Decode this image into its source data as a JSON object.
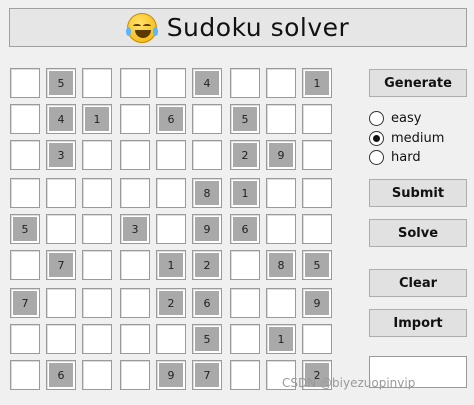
{
  "title": {
    "text": "Sudoku solver",
    "emoji_icon": "face-with-tears-of-joy-icon"
  },
  "board": {
    "grid": [
      [
        0,
        5,
        0,
        0,
        0,
        4,
        0,
        0,
        1
      ],
      [
        0,
        4,
        1,
        0,
        6,
        0,
        5,
        0,
        0
      ],
      [
        0,
        3,
        0,
        0,
        0,
        0,
        2,
        9,
        0
      ],
      [
        0,
        0,
        0,
        0,
        0,
        8,
        1,
        0,
        0
      ],
      [
        5,
        0,
        0,
        3,
        0,
        9,
        6,
        0,
        0
      ],
      [
        0,
        7,
        0,
        0,
        1,
        2,
        0,
        8,
        5
      ],
      [
        7,
        0,
        0,
        0,
        2,
        6,
        0,
        0,
        9
      ],
      [
        0,
        0,
        0,
        0,
        0,
        5,
        0,
        1,
        0
      ],
      [
        0,
        6,
        0,
        0,
        9,
        7,
        0,
        0,
        2
      ]
    ],
    "given_color": "#a9a9a9",
    "empty_color": "#ffffff"
  },
  "buttons": {
    "generate": "Generate",
    "submit": "Submit",
    "solve": "Solve",
    "clear": "Clear",
    "import": "Import"
  },
  "difficulty": {
    "options": [
      "easy",
      "medium",
      "hard"
    ],
    "selected": "medium"
  },
  "output": {
    "value": ""
  },
  "watermark": "CSDN @biyezuopinvip"
}
